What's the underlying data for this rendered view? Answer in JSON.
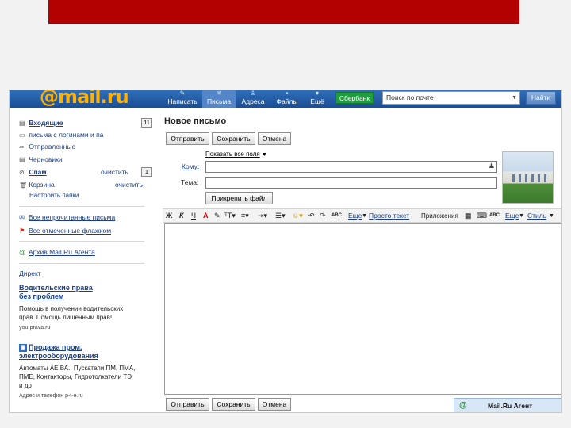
{
  "header": {
    "logo": "@mail.ru",
    "nav": [
      {
        "label": "Написать",
        "icon": "pen-icon"
      },
      {
        "label": "Письма",
        "icon": "envelope-icon"
      },
      {
        "label": "Адреса",
        "icon": "contacts-icon"
      },
      {
        "label": "Файлы",
        "icon": "files-icon"
      },
      {
        "label": "Ещё",
        "icon": "more-icon"
      }
    ],
    "sber_label": "Сбербанк",
    "search_placeholder": "Поиск по почте",
    "search_button": "Найти"
  },
  "sidebar": {
    "folders": [
      {
        "label": "Входящие",
        "count": "11",
        "bold": true,
        "icon": "inbox-icon"
      },
      {
        "label": "письма с логинами и па",
        "icon": "folder-icon"
      },
      {
        "label": "Отправленные",
        "icon": "sent-icon"
      },
      {
        "label": "Черновики",
        "icon": "drafts-icon"
      },
      {
        "label": "Спам",
        "action": "очистить",
        "count": "1",
        "bold": true,
        "icon": "spam-icon"
      },
      {
        "label": "Корзина",
        "action": "очистить",
        "icon": "trash-icon"
      }
    ],
    "setup_folders": "Настроить папки",
    "links": [
      {
        "label": "Все непрочитанные письма",
        "icon": "unread-icon"
      },
      {
        "label": "Все отмеченные флажком",
        "icon": "flag-icon"
      },
      {
        "label": "Архив Mail.Ru Агента",
        "icon": "agent-archive-icon"
      }
    ],
    "ads_header": "Директ",
    "ads": [
      {
        "title_line1": "Водительские права",
        "title_line2": "без проблем",
        "text_line1": "Помощь в получении водительских",
        "text_line2": "прав. Помощь лишенным прав!",
        "url": "you-prava.ru"
      },
      {
        "title_line1": "Продажа пром.",
        "title_line2": "электрооборудования",
        "text_line1": "Автоматы АЕ,ВА., Пускатели ПМ, ПМА,",
        "text_line2": "ПМЕ, Контакторы, Гидротолкатели ТЭ",
        "text_line3": "и др",
        "url": "Адрес и телефон  p-t-e.ru"
      }
    ]
  },
  "compose": {
    "title": "Новое письмо",
    "buttons": {
      "send": "Отправить",
      "save": "Сохранить",
      "cancel": "Отмена"
    },
    "show_all_fields": "Показать все поля",
    "to_label": "Кому:",
    "subject_label": "Тема:",
    "attach_button": "Прикрепить файл",
    "toolbar": {
      "bold": "Ж",
      "italic": "К",
      "underline": "Ч",
      "more_label": "Еще",
      "plain_text": "Просто текст",
      "apps_label": "Приложения",
      "style_label": "Стиль"
    }
  },
  "agent": {
    "label": "Mail.Ru Агент"
  },
  "colors": {
    "slide_bar": "#b30000",
    "header": "#1a4e94",
    "sber": "#1e9e3e"
  }
}
